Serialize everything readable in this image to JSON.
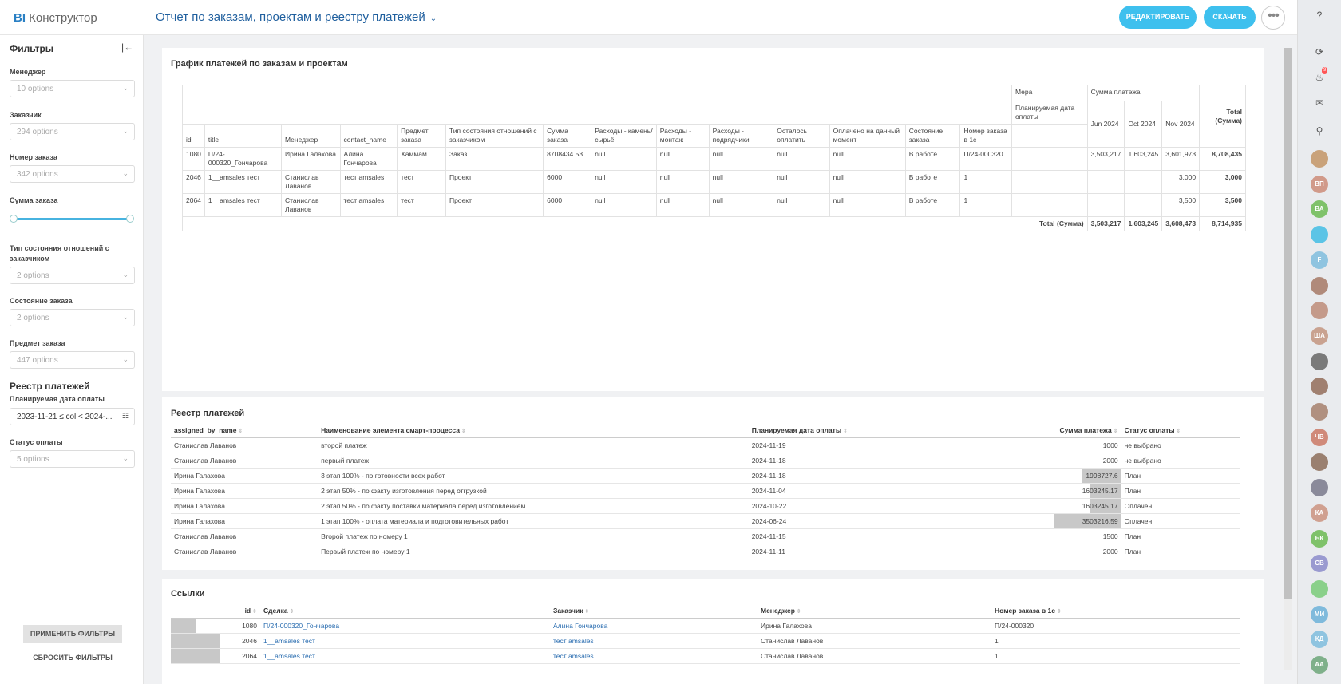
{
  "header": {
    "logo_bi": "BI",
    "logo_text": "Конструктор",
    "title": "Отчет по заказам, проектам и реестру платежей",
    "edit_label": "РЕДАКТИРОВАТЬ",
    "download_label": "СКАЧАТЬ"
  },
  "sidebar": {
    "title": "Фильтры",
    "filters": [
      {
        "label": "Менеджер",
        "placeholder": "10 options"
      },
      {
        "label": "Заказчик",
        "placeholder": "294 options"
      },
      {
        "label": "Номер заказа",
        "placeholder": "342 options"
      },
      {
        "label": "Сумма заказа"
      },
      {
        "label": "Тип состояния отношений с заказчиком",
        "placeholder": "2 options"
      },
      {
        "label": "Состояние заказа",
        "placeholder": "2 options"
      },
      {
        "label": "Предмет заказа",
        "placeholder": "447 options"
      }
    ],
    "section2": "Реестр платежей",
    "date_label": "Планируемая дата оплаты",
    "date_value": "2023-11-21 ≤ col < 2024-...",
    "status_label": "Статус оплаты",
    "status_placeholder": "5 options",
    "apply_label": "ПРИМЕНИТЬ ФИЛЬТРЫ",
    "reset_label": "СБРОСИТЬ ФИЛЬТРЫ"
  },
  "pivot": {
    "title": "График платежей по заказам и проектам",
    "mera": "Мера",
    "sum_header": "Сумма платежа",
    "planned_date": "Планируемая дата оплаты",
    "months": [
      "Jun 2024",
      "Oct 2024",
      "Nov 2024"
    ],
    "total_label": "Total (Сумма)",
    "columns": [
      "id",
      "title",
      "Менеджер",
      "contact_name",
      "Предмет заказа",
      "Тип состояния отношений с заказчиком",
      "Сумма заказа",
      "Расходы - камень/сырьё",
      "Расходы - монтаж",
      "Расходы - подрядчики",
      "Осталось оплатить",
      "Оплачено на данный момент",
      "Состояние заказа",
      "Номер заказа в 1с"
    ],
    "rows": [
      {
        "cells": [
          "1080",
          "П/24-000320_Гончарова",
          "Ирина Галахова",
          "Алина Гончарова",
          "Хаммам",
          "Заказ",
          "8708434.53",
          "null",
          "null",
          "null",
          "null",
          "null",
          "В работе",
          "П/24-000320"
        ],
        "m": [
          "3,503,217",
          "1,603,245",
          "3,601,973"
        ],
        "total": "8,708,435"
      },
      {
        "cells": [
          "2046",
          "1__amsales тест",
          "Станислав Лаванов",
          "тест amsales",
          "тест",
          "Проект",
          "6000",
          "null",
          "null",
          "null",
          "null",
          "null",
          "В работе",
          "1"
        ],
        "m": [
          "",
          "",
          "3,000"
        ],
        "total": "3,000"
      },
      {
        "cells": [
          "2064",
          "1__amsales тест",
          "Станислав Лаванов",
          "тест amsales",
          "тест",
          "Проект",
          "6000",
          "null",
          "null",
          "null",
          "null",
          "null",
          "В работе",
          "1"
        ],
        "m": [
          "",
          "",
          "3,500"
        ],
        "total": "3,500"
      }
    ],
    "totals": [
      "3,503,217",
      "1,603,245",
      "3,608,473",
      "8,714,935"
    ]
  },
  "registry": {
    "title": "Реестр платежей",
    "headers": [
      "assigned_by_name",
      "Наименование элемента смарт-процесса",
      "Планируемая дата оплаты",
      "Сумма платежа",
      "Статус оплаты"
    ],
    "max": 3503216.59,
    "rows": [
      {
        "name": "Станислав Лаванов",
        "item": "второй платеж",
        "date": "2024-11-19",
        "sum": "1000",
        "value": 1000,
        "status": "не выбрано"
      },
      {
        "name": "Станислав Лаванов",
        "item": "первый платеж",
        "date": "2024-11-18",
        "sum": "2000",
        "value": 2000,
        "status": "не выбрано"
      },
      {
        "name": "Ирина Галахова",
        "item": "3 этап 100% - по готовности всех работ",
        "date": "2024-11-18",
        "sum": "1998727.6",
        "value": 1998727.6,
        "status": "План"
      },
      {
        "name": "Ирина Галахова",
        "item": "2 этап 50% - по факту изготовления перед отгрузкой",
        "date": "2024-11-04",
        "sum": "1603245.17",
        "value": 1603245.17,
        "status": "План"
      },
      {
        "name": "Ирина Галахова",
        "item": "2 этап 50% - по факту поставки материала перед изготовлением",
        "date": "2024-10-22",
        "sum": "1603245.17",
        "value": 1603245.17,
        "status": "Оплачен"
      },
      {
        "name": "Ирина Галахова",
        "item": "1 этап 100% - оплата материала и подготовительных работ",
        "date": "2024-06-24",
        "sum": "3503216.59",
        "value": 3503216.59,
        "status": "Оплачен"
      },
      {
        "name": "Станислав Лаванов",
        "item": "Второй платеж по номеру 1",
        "date": "2024-11-15",
        "sum": "1500",
        "value": 1500,
        "status": "План"
      },
      {
        "name": "Станислав Лаванов",
        "item": "Первый платеж по номеру 1",
        "date": "2024-11-11",
        "sum": "2000",
        "value": 2000,
        "status": "План"
      }
    ]
  },
  "links": {
    "title": "Ссылки",
    "headers": [
      "id",
      "Сделка",
      "Заказчик",
      "Менеджер",
      "Номер заказа в 1с"
    ],
    "max": 2064,
    "rows": [
      {
        "id": "1080",
        "value": 1080,
        "deal": "П/24-000320_Гончарова",
        "client": "Алина Гончарова",
        "manager": "Ирина Галахова",
        "num": "П/24-000320"
      },
      {
        "id": "2046",
        "value": 2046,
        "deal": "1__amsales тест",
        "client": "тест amsales",
        "manager": "Станислав Лаванов",
        "num": "1"
      },
      {
        "id": "2064",
        "value": 2064,
        "deal": "1__amsales тест",
        "client": "тест amsales",
        "manager": "Станислав Лаванов",
        "num": "1"
      }
    ]
  },
  "rail": {
    "avatars": [
      {
        "initials": "",
        "color": "#c9a27a"
      },
      {
        "initials": "ВП",
        "color": "#d19a8a"
      },
      {
        "initials": "ВА",
        "color": "#7fc26a"
      },
      {
        "initials": "",
        "color": "#5bc4e6"
      },
      {
        "initials": "F",
        "color": "#8fc4e0"
      },
      {
        "initials": "",
        "color": "#b08a7a"
      },
      {
        "initials": "",
        "color": "#c49a8a"
      },
      {
        "initials": "ША",
        "color": "#c9a290"
      },
      {
        "initials": "",
        "color": "#7a7a7a"
      },
      {
        "initials": "",
        "color": "#a08070"
      },
      {
        "initials": "",
        "color": "#b09080"
      },
      {
        "initials": "ЧВ",
        "color": "#d08a7a"
      },
      {
        "initials": "",
        "color": "#9a8070"
      },
      {
        "initials": "",
        "color": "#8a8a9a"
      },
      {
        "initials": "КА",
        "color": "#d0a090"
      },
      {
        "initials": "БК",
        "color": "#7fc26a"
      },
      {
        "initials": "СВ",
        "color": "#9a9ad0"
      },
      {
        "initials": "",
        "color": "#8ad08a"
      },
      {
        "initials": "МИ",
        "color": "#7fbadc"
      },
      {
        "initials": "КД",
        "color": "#8fc4e0"
      },
      {
        "initials": "АА",
        "color": "#7fb08a"
      }
    ],
    "badge": "9"
  }
}
